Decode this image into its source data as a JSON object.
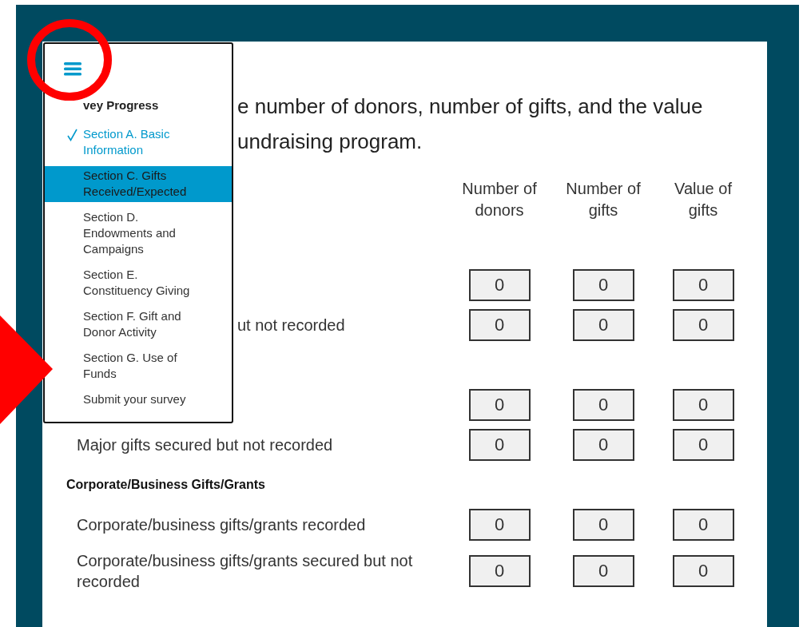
{
  "menu": {
    "title": "vey Progress",
    "items": [
      {
        "label": "Section A. Basic Information",
        "done": true,
        "selected": false
      },
      {
        "label": "Section C. Gifts Received/Expected",
        "done": false,
        "selected": true
      },
      {
        "label": "Section D. Endowments and Campaigns",
        "done": false,
        "selected": false
      },
      {
        "label": "Section E. Constituency Giving",
        "done": false,
        "selected": false
      },
      {
        "label": "Section F. Gift and Donor Activity",
        "done": false,
        "selected": false
      },
      {
        "label": "Section G. Use of Funds",
        "done": false,
        "selected": false
      },
      {
        "label": "Submit your survey",
        "done": false,
        "selected": false
      }
    ]
  },
  "question": [
    "e number of donors, number of gifts, and the value",
    "undraising program."
  ],
  "columns": [
    "Number of donors",
    "Number of gifts",
    "Value of gifts"
  ],
  "groups": [
    {
      "rows": [
        {
          "values": [
            "0",
            "0",
            "0"
          ]
        },
        {
          "label": "ut not recorded",
          "values": [
            "0",
            "0",
            "0"
          ]
        }
      ]
    },
    {
      "rows": [
        {
          "values": [
            "0",
            "0",
            "0"
          ]
        },
        {
          "label": "Major gifts secured but not recorded",
          "values": [
            "0",
            "0",
            "0"
          ]
        }
      ]
    },
    {
      "header": "Corporate/Business Gifts/Grants",
      "rows": [
        {
          "label": "Corporate/business gifts/grants recorded",
          "values": [
            "0",
            "0",
            "0"
          ]
        },
        {
          "label": "Corporate/business gifts/grants secured but not recorded",
          "values": [
            "0",
            "0",
            "0"
          ]
        }
      ]
    }
  ]
}
